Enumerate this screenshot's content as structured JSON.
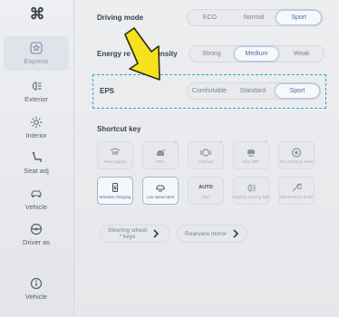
{
  "sidebar": {
    "logo": "⌘",
    "items": [
      {
        "label": "Express"
      },
      {
        "label": "Exterior"
      },
      {
        "label": "Interior"
      },
      {
        "label": "Seat adj"
      },
      {
        "label": "Vehicle"
      },
      {
        "label": "Driver as"
      },
      {
        "label": "Vehicle"
      }
    ]
  },
  "driving_mode": {
    "title": "Driving mode",
    "options": [
      "ECO",
      "Normal",
      "Sport"
    ],
    "selected": "Sport"
  },
  "energy": {
    "title_left": "Energy re",
    "title_right": "tensity",
    "options": [
      "Strong",
      "Medium",
      "Weak"
    ],
    "selected": "Medium"
  },
  "eps": {
    "title": "EPS",
    "options": [
      "Comfortable",
      "Standard",
      "Sport"
    ],
    "selected": "Sport"
  },
  "shortcut": {
    "title": "Shortcut key",
    "row1": [
      {
        "label": "Rear tailgate"
      },
      {
        "label": "PDC"
      },
      {
        "label": "Autohold"
      },
      {
        "label": "ESL OFF"
      },
      {
        "label": "Tire pressure reset"
      }
    ],
    "row2": [
      {
        "label": "Wireless charging"
      },
      {
        "label": "Low speed alert"
      },
      {
        "label": "HBC",
        "icon_text": "AUTO"
      },
      {
        "label": "Daytime running light"
      },
      {
        "label": "Maintenance mode"
      }
    ]
  },
  "links": {
    "steering_line1": "Steering wheel",
    "steering_line2": "* keys",
    "rearview": "Rearview mirror"
  },
  "colors": {
    "accent": "#4a6cc4",
    "dashed_highlight": "#2aa7d9",
    "pointer_arrow": "#f5e21c"
  }
}
